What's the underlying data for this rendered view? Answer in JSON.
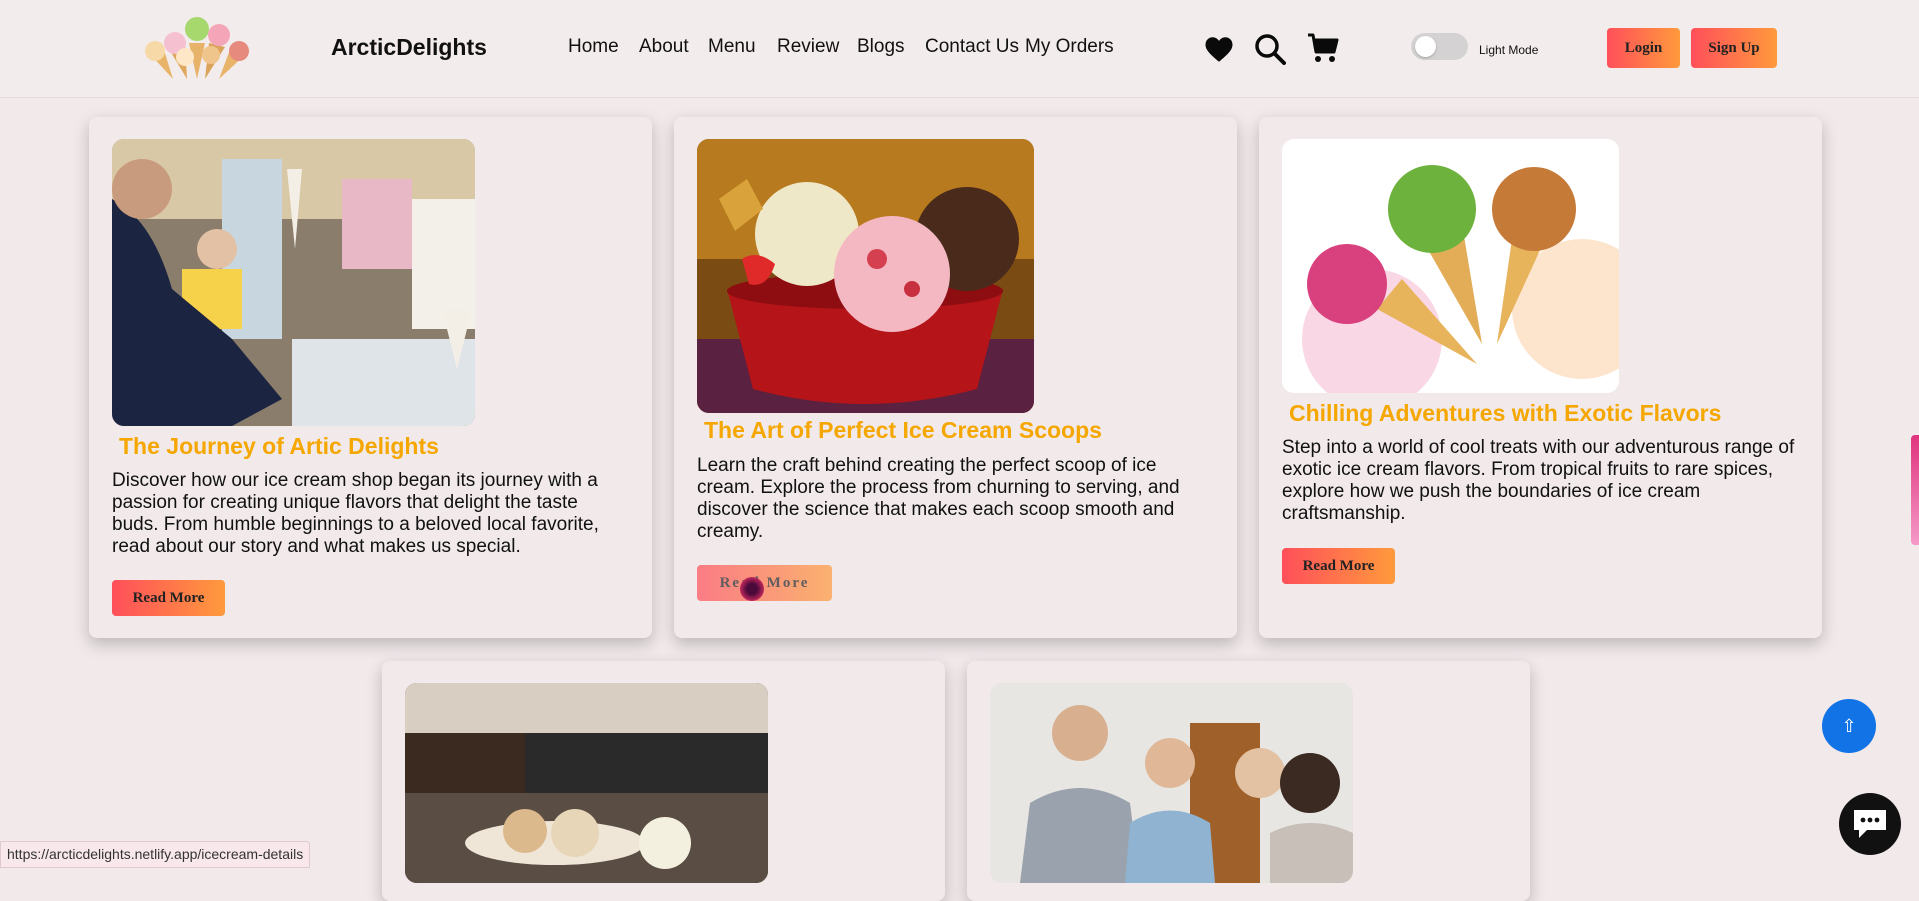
{
  "header": {
    "brand": "ArcticDelights",
    "nav": [
      "Home",
      "About",
      "Menu",
      "Review",
      "Blogs",
      "Contact Us",
      "My Orders"
    ],
    "icons": [
      "heart-icon",
      "search-icon",
      "cart-icon"
    ],
    "toggle_label": "Light Mode",
    "login_label": "Login",
    "signup_label": "Sign Up"
  },
  "cards": [
    {
      "title": "The Journey of Artic Delights",
      "text": "Discover how our ice cream shop began its journey with a passion for creating unique flavors that delight the taste buds. From humble beginnings to a beloved local favorite, read about our story and what makes us special.",
      "button": "Read More"
    },
    {
      "title": "The Art of Perfect Ice Cream Scoops",
      "text": "Learn the craft behind creating the perfect scoop of ice cream. Explore the process from churning to serving, and discover the science that makes each scoop smooth and creamy.",
      "button": "Read More"
    },
    {
      "title": "Chilling Adventures with Exotic Flavors",
      "text": "Step into a world of cool treats with our adventurous range of exotic ice cream flavors. From tropical fruits to rare spices, explore how we push the boundaries of ice cream craftsmanship.",
      "button": "Read More"
    }
  ],
  "status_url": "https://arcticdelights.netlify.app/icecream-details",
  "scroll_top_icon": "⇧",
  "colors": {
    "accent": "#f5a700",
    "button_start": "#ff4f5a",
    "button_end": "#ff9a3c",
    "scroll_button": "#1273e6"
  }
}
